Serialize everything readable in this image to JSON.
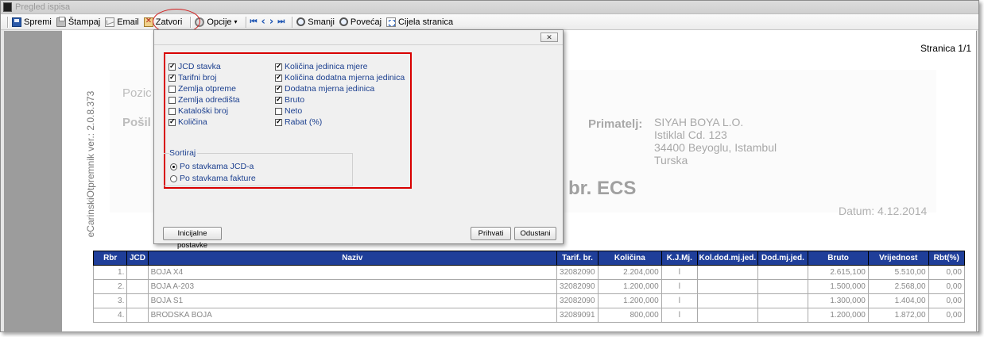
{
  "window": {
    "title": "Pregled ispisa"
  },
  "toolbar": {
    "spremi": "Spremi",
    "stampaj": "Štampaj",
    "email": "Email",
    "zatvori": "Zatvori",
    "opcije": "Opcije",
    "opcije_caret": "▾",
    "nav_first": "⏮",
    "nav_prev": "‹",
    "nav_next": "›",
    "nav_last": "⏭",
    "smanji": "Smanji",
    "povecaj": "Povećaj",
    "cijela_stranica": "Cijela stranica"
  },
  "document": {
    "page_number": "Stranica 1/1",
    "version_text": "eCarinskiOtpremnik ver.: 2.0.8.373",
    "pozicija_partial": "Pozic",
    "posiljatelj_partial": "Pošil",
    "primatelj_label": "Primatelj:",
    "primatelj_lines": [
      "SIYAH BOYA L.O.",
      "Istiklal Cd. 123",
      "34400 Beyoglu, Istambul",
      "Turska"
    ],
    "ecs_title": "br. ECS",
    "datum": "Datum: 4.12.2014"
  },
  "table": {
    "headers": [
      "Rbr",
      "JCD",
      "Naziv",
      "Tarif. br.",
      "Količina",
      "K.J.Mj.",
      "Kol.dod.mj.jed.",
      "Dod.mj.jed.",
      "Bruto",
      "Vrijednost",
      "Rbt(%)"
    ],
    "rows": [
      [
        "1.",
        "",
        "BOJA X4",
        "32082090",
        "2.204,000",
        "l",
        "",
        "",
        "2.615,100",
        "5.510,00",
        "0,00"
      ],
      [
        "2.",
        "",
        "BOJA A-203",
        "32082090",
        "1.200,000",
        "l",
        "",
        "",
        "1.500,000",
        "2.568,00",
        "0,00"
      ],
      [
        "3.",
        "",
        "BOJA S1",
        "32082090",
        "1.200,000",
        "l",
        "",
        "",
        "1.300,000",
        "1.404,00",
        "0,00"
      ],
      [
        "4.",
        "",
        "BRODSKA BOJA",
        "32089091",
        "800,000",
        "l",
        "",
        "",
        "1.200,000",
        "1.872,00",
        "0,00"
      ]
    ]
  },
  "dialog": {
    "close_glyph": "✕",
    "left_options": [
      {
        "label": "JCD stavka",
        "checked": true
      },
      {
        "label": "Tarifni broj",
        "checked": true
      },
      {
        "label": "Zemlja otpreme",
        "checked": false
      },
      {
        "label": "Zemlja odredišta",
        "checked": false
      },
      {
        "label": "Kataloški broj",
        "checked": false
      },
      {
        "label": "Količina",
        "checked": true
      }
    ],
    "right_options": [
      {
        "label": "Količina jedinica mjere",
        "checked": true
      },
      {
        "label": "Količina dodatna mjerna jedinica",
        "checked": true
      },
      {
        "label": "Dodatna mjerna jedinica",
        "checked": true
      },
      {
        "label": "Bruto",
        "checked": true
      },
      {
        "label": "Neto",
        "checked": false
      },
      {
        "label": "Rabat (%)",
        "checked": true
      }
    ],
    "sort_title": "Sortiraj",
    "sort_options": [
      {
        "label": "Po stavkama JCD-a",
        "selected": true
      },
      {
        "label": "Po stavkama fakture",
        "selected": false
      }
    ],
    "initial_button": "Inicijalne postavke",
    "accept_button": "Prihvati",
    "cancel_button": "Odustani"
  },
  "colors": {
    "table_header": "#1f3e99",
    "highlight_red": "#d80000",
    "option_text": "#1b3f8f",
    "nav_arrow": "#1f56b3"
  }
}
